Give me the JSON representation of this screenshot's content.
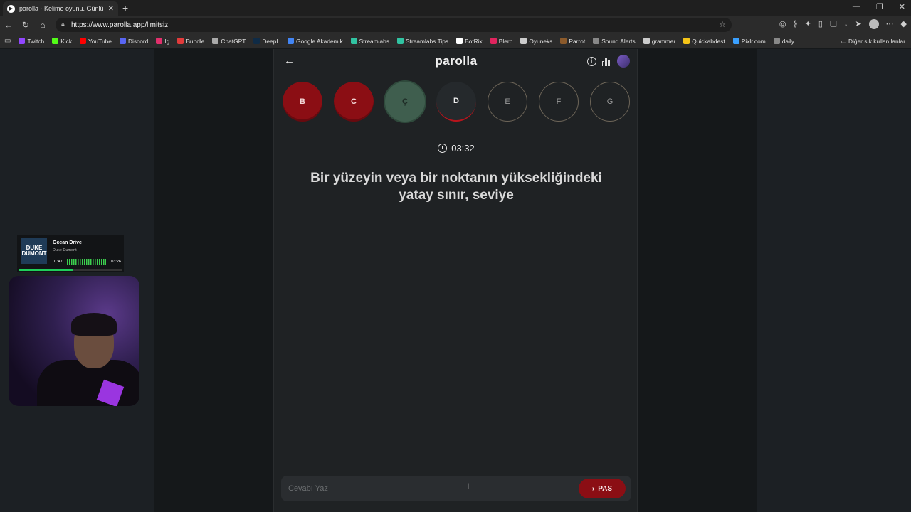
{
  "browser": {
    "tab_title": "parolla - Kelime oyunu. Günlük k",
    "tab_close": "✕",
    "new_tab": "+",
    "url": "https://www.parolla.app/limitsiz",
    "win_controls": [
      "—",
      "❐",
      "✕"
    ]
  },
  "bookmarks": [
    {
      "label": "Twitch",
      "color": "#9146ff"
    },
    {
      "label": "Kick",
      "color": "#53fc18"
    },
    {
      "label": "YouTube",
      "color": "#ff0000"
    },
    {
      "label": "Discord",
      "color": "#5865f2"
    },
    {
      "label": "Ig",
      "color": "#e1306c"
    },
    {
      "label": "Bundle",
      "color": "#e23b3b"
    },
    {
      "label": "ChatGPT",
      "color": "#aaaaaa"
    },
    {
      "label": "DeepL",
      "color": "#0f2b46"
    },
    {
      "label": "Google Akademik",
      "color": "#4285f4"
    },
    {
      "label": "Streamlabs",
      "color": "#31c3a2"
    },
    {
      "label": "Streamlabs Tips",
      "color": "#31c3a2"
    },
    {
      "label": "BotRix",
      "color": "#ffffff"
    },
    {
      "label": "Blerp",
      "color": "#e0245e"
    },
    {
      "label": "Oyuneks",
      "color": "#cccccc"
    },
    {
      "label": "Parrot",
      "color": "#8b5a2b"
    },
    {
      "label": "Sound Alerts",
      "color": "#888888"
    },
    {
      "label": "grammer",
      "color": "#cccccc"
    },
    {
      "label": "Quickabdest",
      "color": "#f5c518"
    },
    {
      "label": "Pixlr.com",
      "color": "#3aa0ff"
    },
    {
      "label": "daily",
      "color": "#888888"
    }
  ],
  "bookmarks_other": "Diğer sık kullanılanlar",
  "game": {
    "brand": "parolla",
    "back_glyph": "←",
    "letters": [
      {
        "label": "B",
        "state": "wrong"
      },
      {
        "label": "C",
        "state": "wrong"
      },
      {
        "label": "Ç",
        "state": "correct"
      },
      {
        "label": "D",
        "state": "current"
      },
      {
        "label": "E",
        "state": "pending"
      },
      {
        "label": "F",
        "state": "pending"
      },
      {
        "label": "G",
        "state": "pending"
      }
    ],
    "timer": "03:32",
    "question": "Bir yüzeyin veya bir noktanın yüksekliğindeki yatay sınır, seviye",
    "answer_placeholder": "Cevabı Yaz",
    "pas_label": "PAS",
    "pas_glyph": "›"
  },
  "music_widget": {
    "album_text": "DUKE DUMONT",
    "song": "Ocean Drive",
    "artist": "Duke Dumont",
    "time_current": "01:47",
    "time_total": "03:26",
    "progress": 0.52
  }
}
